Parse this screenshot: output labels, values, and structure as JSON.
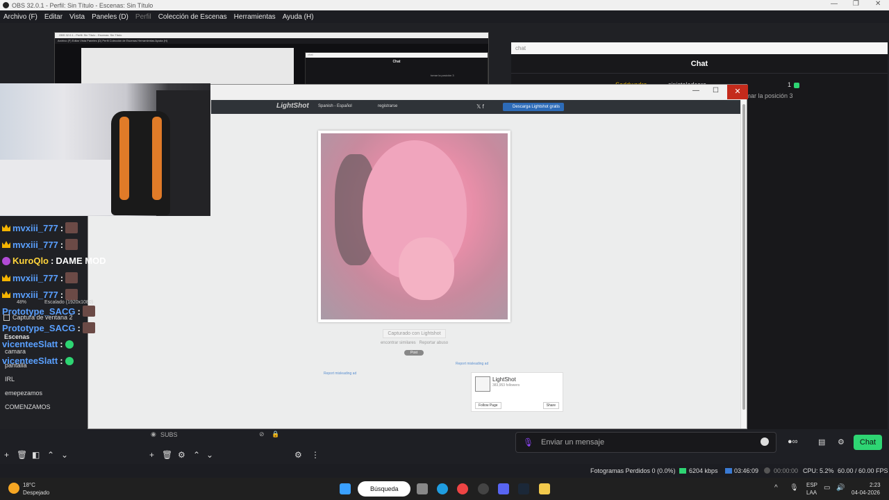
{
  "titlebar": {
    "title": "OBS 32.0.1 - Perfil: Sin Título - Escenas: Sin Título",
    "min": "—",
    "max": "❐",
    "close": "✕"
  },
  "menu": [
    "Archivo (F)",
    "Editar",
    "Vista",
    "Paneles (D)",
    "Perfil",
    "Colección de Escenas",
    "Herramientas",
    "Ayuda (H)"
  ],
  "nested": {
    "title": "OBS 32.0.1 - Perfil: Sin Título - Escenas: Sin Título",
    "menu": "Archivo (F)   Editar   Vista   Paneles (D)   Perfil   Colección de Escenas   Herramientas   Ayuda (H)",
    "chat_title": "Chat",
    "chat_line": "tomar la posición 3",
    "address": "chat"
  },
  "chatpanel": {
    "address": "chat",
    "title": "Chat",
    "line1_left": "Seddwadre",
    "line1_right": "sinistaledcore",
    "line1_count": "1",
    "line2": "tomar la posición 3"
  },
  "chatinput": {
    "placeholder": "Enviar un mensaje",
    "send": "Chat"
  },
  "chat_messages": [
    {
      "user": "mvxiii_777",
      "type": "crown"
    },
    {
      "user": "mvxiii_777",
      "type": "crown"
    },
    {
      "user": "KuroQlo",
      "type": "kuro",
      "text": "DAME MOD"
    },
    {
      "user": "mvxiii_777",
      "type": "crown"
    },
    {
      "user": "mvxiii_777",
      "type": "crown"
    },
    {
      "user": "Prototype_SACG",
      "type": "plain"
    },
    {
      "user": "Prototype_SACG",
      "type": "plain"
    },
    {
      "user": "vicenteeSlatt",
      "type": "gem"
    },
    {
      "user": "vicenteeSlatt",
      "type": "gem"
    }
  ],
  "overlay": {
    "zoom": "48%",
    "scale": "Escalado (1920x1080)"
  },
  "capture_window": "Captura de ventana 2",
  "scenes": {
    "title": "Escenas",
    "items": [
      "camara",
      "pantalla",
      "IRL",
      "emepezamos",
      "COMENZAMOS"
    ]
  },
  "sources": {
    "item": "SUBS"
  },
  "lightshot": {
    "brand": "LightShot",
    "language": "Spanish - Español",
    "register": "registrarse",
    "download": "Descarga Lightshot gratis",
    "caption": "Capturado con Lightshot",
    "find_similar": "encontrar similares",
    "report": "Reportar abuso",
    "post": "Post",
    "ad1": "Report misleading ad",
    "ad2": "Report misleading ad",
    "fb_name": "LightShot",
    "fb_followers": "383,953 followers",
    "fb_follow": "Follow Page",
    "fb_share": "Share"
  },
  "status": {
    "dropped": "Fotogramas Perdidos 0 (0.0%)",
    "kbps": "6204 kbps",
    "rec_time": "03:46:09",
    "stream_time": "00:00:00",
    "cpu": "CPU: 5.2%",
    "fps": "60.00 / 60.00 FPS"
  },
  "taskbar": {
    "temp": "18°C",
    "weather": "Despejado",
    "search": "Búsqueda",
    "lang1": "ESP",
    "lang2": "LAA",
    "time": "2:23",
    "date": "04-04-2026"
  },
  "colors": {
    "accent": "#2ed573",
    "twitch": "#9147ff",
    "close": "#c42b1c"
  }
}
